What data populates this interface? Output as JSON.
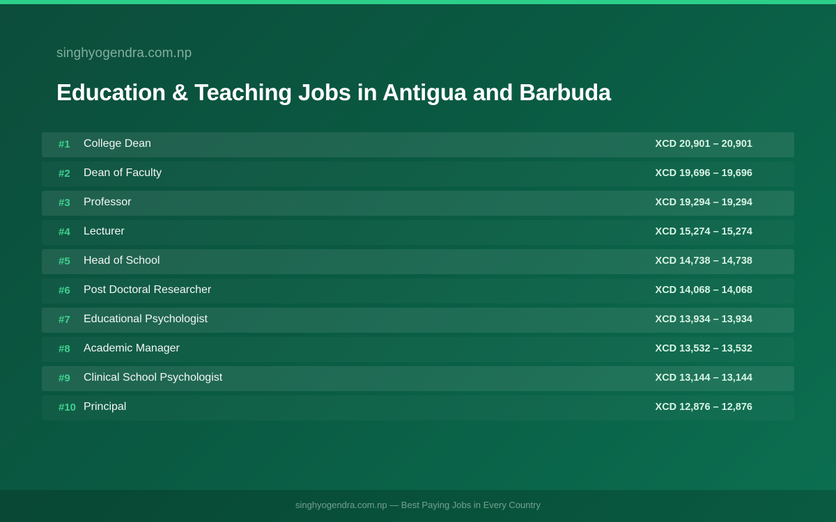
{
  "header": {
    "site_name": "singhyogendra.com.np",
    "title": "Education & Teaching Jobs in Antigua and Barbuda"
  },
  "jobs": [
    {
      "rank": "#1",
      "title": "College Dean",
      "salary": "XCD 20,901 – 20,901"
    },
    {
      "rank": "#2",
      "title": "Dean of Faculty",
      "salary": "XCD 19,696 – 19,696"
    },
    {
      "rank": "#3",
      "title": "Professor",
      "salary": "XCD 19,294 – 19,294"
    },
    {
      "rank": "#4",
      "title": "Lecturer",
      "salary": "XCD 15,274 – 15,274"
    },
    {
      "rank": "#5",
      "title": "Head of School",
      "salary": "XCD 14,738 – 14,738"
    },
    {
      "rank": "#6",
      "title": "Post Doctoral Researcher",
      "salary": "XCD 14,068 – 14,068"
    },
    {
      "rank": "#7",
      "title": "Educational Psychologist",
      "salary": "XCD 13,934 – 13,934"
    },
    {
      "rank": "#8",
      "title": "Academic Manager",
      "salary": "XCD 13,532 – 13,532"
    },
    {
      "rank": "#9",
      "title": "Clinical School Psychologist",
      "salary": "XCD 13,144 – 13,144"
    },
    {
      "rank": "#10",
      "title": "Principal",
      "salary": "XCD 12,876 – 12,876"
    }
  ],
  "footer": {
    "text": "singhyogendra.com.np — Best Paying Jobs in Every Country"
  },
  "colors": {
    "accent": "#2ccf8a",
    "rank": "#3fd08f",
    "background": "#0a5a42"
  }
}
